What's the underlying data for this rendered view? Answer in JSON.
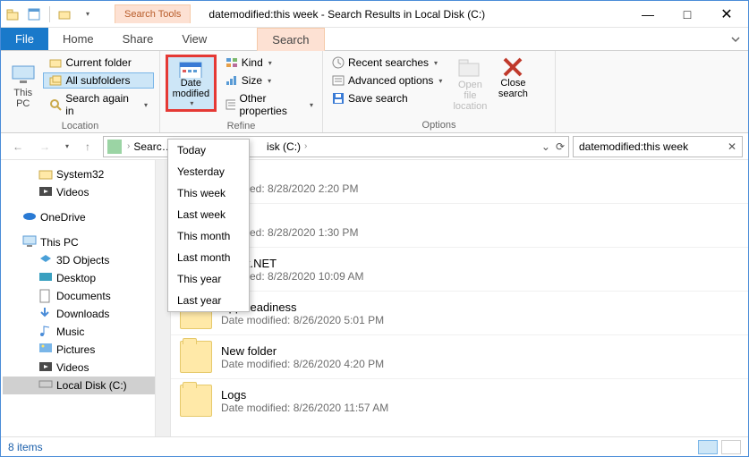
{
  "window": {
    "context_tab_label": "Search Tools",
    "title": "datemodified:this week - Search Results in Local Disk (C:)"
  },
  "tabs": {
    "file": "File",
    "home": "Home",
    "share": "Share",
    "view": "View",
    "search": "Search"
  },
  "ribbon": {
    "location": {
      "this_pc": "This\nPC",
      "current_folder": "Current folder",
      "all_subfolders": "All subfolders",
      "search_again": "Search again in",
      "section": "Location"
    },
    "refine": {
      "date_modified": "Date\nmodified",
      "kind": "Kind",
      "size": "Size",
      "other_props": "Other properties",
      "section": "Refine"
    },
    "options": {
      "recent_searches": "Recent searches",
      "advanced": "Advanced options",
      "save_search": "Save search",
      "open_location": "Open file\nlocation",
      "close_search": "Close\nsearch",
      "section": "Options"
    }
  },
  "date_menu": [
    "Today",
    "Yesterday",
    "This week",
    "Last week",
    "This month",
    "Last month",
    "This year",
    "Last year"
  ],
  "address": {
    "crumb1": "Searc…",
    "crumb2": "isk (C:)"
  },
  "search_field": "datemodified:this week",
  "tree": {
    "system32": "System32",
    "videos1": "Videos",
    "onedrive": "OneDrive",
    "this_pc": "This PC",
    "objects3d": "3D Objects",
    "desktop": "Desktop",
    "documents": "Documents",
    "downloads": "Downloads",
    "music": "Music",
    "pictures": "Pictures",
    "videos2": "Videos",
    "localdisk": "Local Disk (C:)"
  },
  "results": [
    {
      "name": "p",
      "meta": "modified: 8/28/2020 2:20 PM"
    },
    {
      "name": "etch",
      "meta": "modified: 8/28/2020 1:30 PM"
    },
    {
      "name": "rosoft.NET",
      "meta": "modified: 8/28/2020 10:09 AM"
    },
    {
      "name": "AppReadiness",
      "meta": "Date modified: 8/26/2020 5:01 PM"
    },
    {
      "name": "New folder",
      "meta": "Date modified: 8/26/2020 4:20 PM"
    },
    {
      "name": "Logs",
      "meta": "Date modified: 8/26/2020 11:57 AM"
    }
  ],
  "status": {
    "count": "8 items"
  }
}
